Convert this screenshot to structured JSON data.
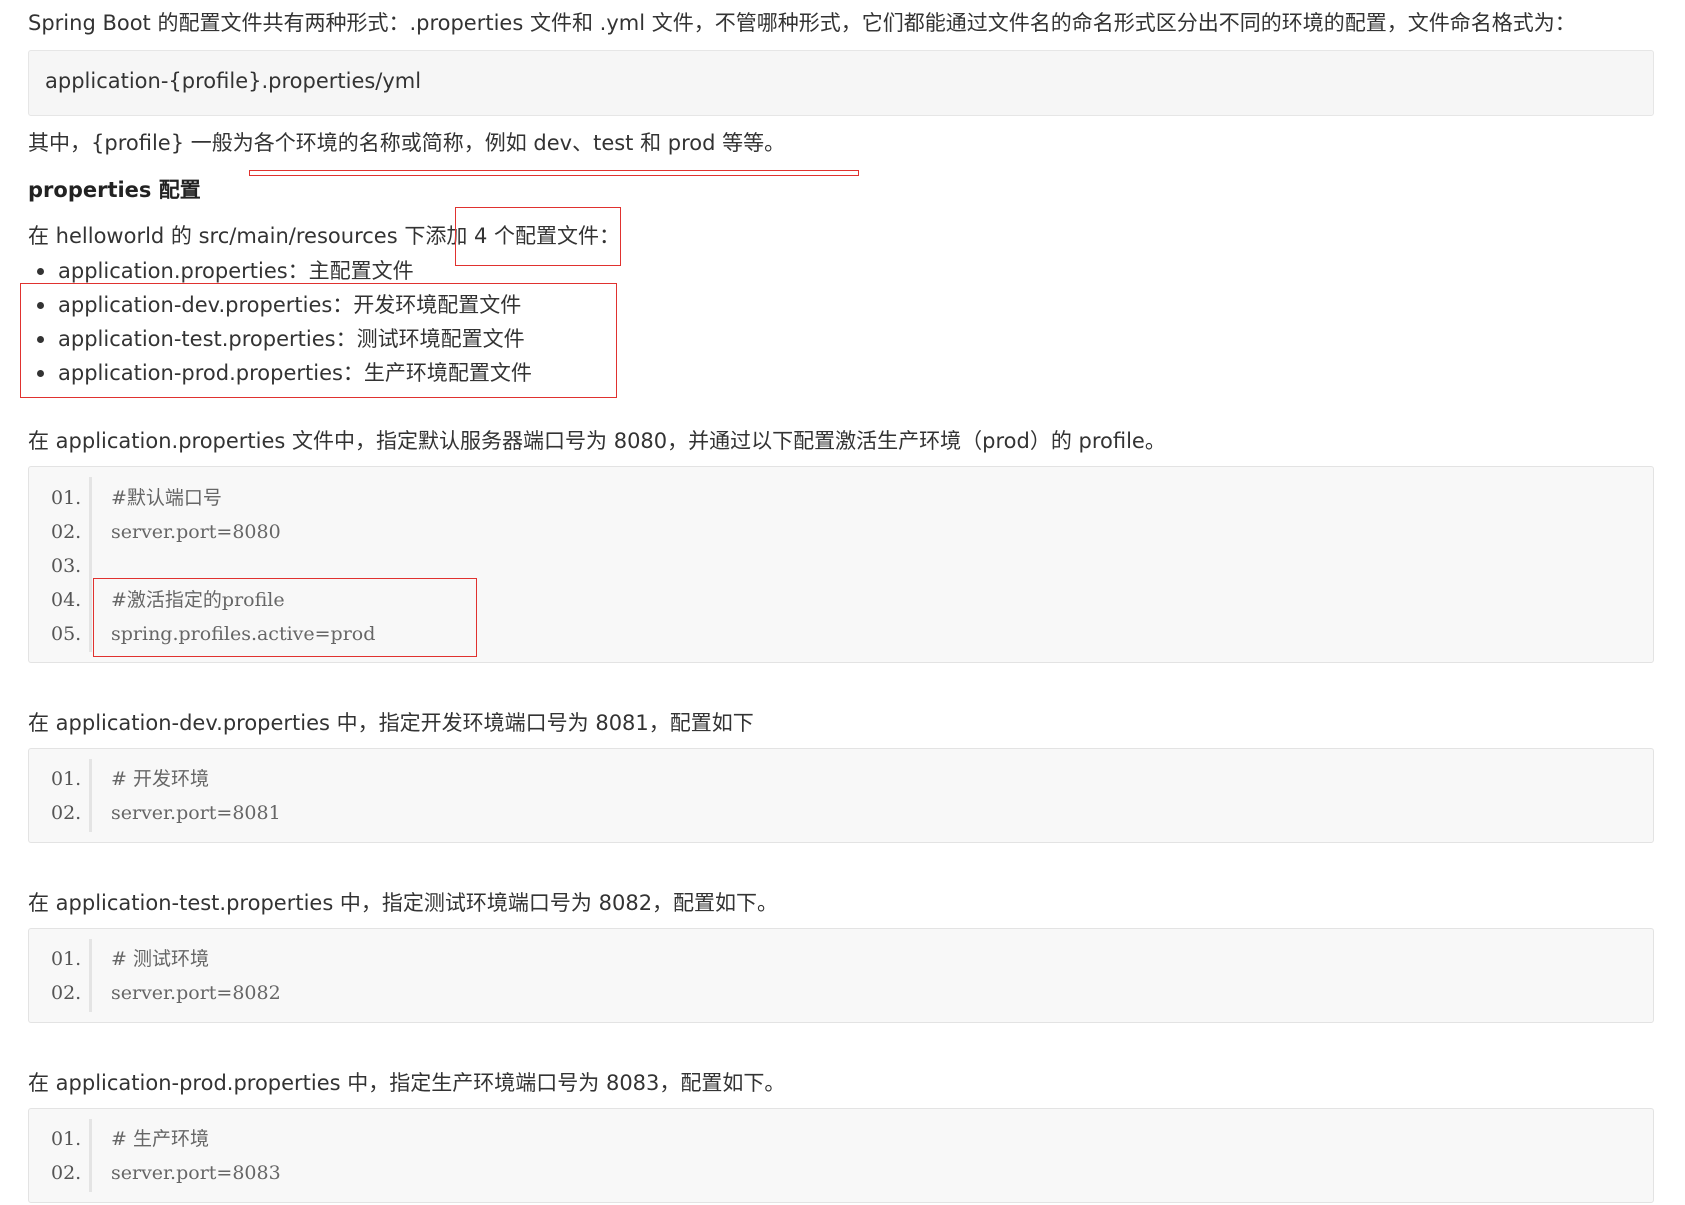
{
  "intro": "Spring Boot 的配置文件共有两种形式：.properties  文件和 .yml 文件，不管哪种形式，它们都能通过文件名的命名形式区分出不同的环境的配置，文件命名格式为：",
  "naming_format": "application-{profile}.properties/yml",
  "profile_note": "其中，{profile} 一般为各个环境的名称或简称，例如 dev、test 和 prod 等等。",
  "section_heading": "properties 配置",
  "add_files_text": "在 helloworld 的 src/main/resources 下添加 4 个配置文件：",
  "files": [
    "application.properties：主配置文件",
    "application-dev.properties：开发环境配置文件",
    "application-test.properties：测试环境配置文件",
    "application-prod.properties：生产环境配置文件"
  ],
  "main_config": {
    "description": "在 application.properties 文件中，指定默认服务器端口号为 8080，并通过以下配置激活生产环境（prod）的 profile。",
    "lines": [
      {
        "no": "01.",
        "code": "#默认端口号"
      },
      {
        "no": "02.",
        "code": "server.port=8080"
      },
      {
        "no": "03.",
        "code": ""
      },
      {
        "no": "04.",
        "code": "#激活指定的profile"
      },
      {
        "no": "05.",
        "code": "spring.profiles.active=prod"
      }
    ]
  },
  "dev_config": {
    "description": "在 application-dev.properties 中，指定开发环境端口号为 8081，配置如下",
    "lines": [
      {
        "no": "01.",
        "code": "# 开发环境"
      },
      {
        "no": "02.",
        "code": "server.port=8081"
      }
    ]
  },
  "test_config": {
    "description": "在 application-test.properties 中，指定测试环境端口号为 8082，配置如下。",
    "lines": [
      {
        "no": "01.",
        "code": "# 测试环境"
      },
      {
        "no": "02.",
        "code": "server.port=8082"
      }
    ]
  },
  "prod_config": {
    "description": "在 application-prod.properties 中，指定生产环境端口号为 8083，配置如下。",
    "lines": [
      {
        "no": "01.",
        "code": "# 生产环境"
      },
      {
        "no": "02.",
        "code": "server.port=8083"
      }
    ]
  },
  "colors": {
    "annotation": "#e0322f",
    "code_background": "#f8f8f8",
    "text": "#333333"
  }
}
